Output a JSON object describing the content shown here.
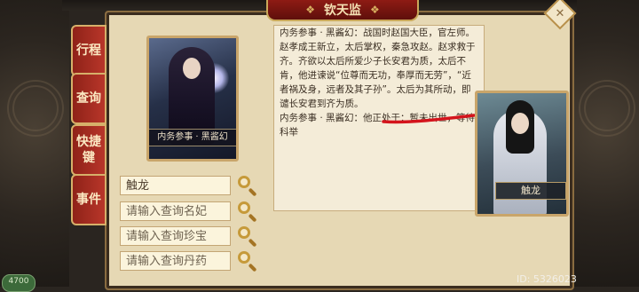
{
  "window": {
    "title": "钦天监"
  },
  "side_tabs": [
    {
      "label": "行程"
    },
    {
      "label": "查询"
    },
    {
      "label": "快捷键"
    },
    {
      "label": "事件"
    }
  ],
  "portrait_card": {
    "label": "内务参事 · 黑酱幻"
  },
  "search_fields": [
    {
      "value": "触龙",
      "placeholder": ""
    },
    {
      "value": "",
      "placeholder": "请输入查询名妃"
    },
    {
      "value": "",
      "placeholder": "请输入查询珍宝"
    },
    {
      "value": "",
      "placeholder": "请输入查询丹药"
    }
  ],
  "info": {
    "paragraph_1": "内务参事 · 黑酱幻：战国时赵国大臣，官左师。赵孝成王新立，太后掌权，秦急攻赵。赵求救于齐。齐欲以太后所爱少子长安君为质，太后不肯，他进谏说“位尊而无功，奉厚而无劳”，“近者祸及身，远者及其子孙”。太后为其所动，即谴长安君到齐为质。",
    "paragraph_2": "内务参事 · 黑酱幻：他正处于：暂未出世，等待科举"
  },
  "character_card": {
    "name": "触龙"
  },
  "footer": {
    "id_text": "ID: 5326023",
    "badge": "4700"
  },
  "colors": {
    "accent_red": "#8e1b14",
    "panel": "#e6d8b4",
    "gold": "#c9a56a",
    "annotation_red": "#d4141c"
  },
  "icons": {
    "close": "diamond-close-icon",
    "search": "magnifier-icon"
  }
}
